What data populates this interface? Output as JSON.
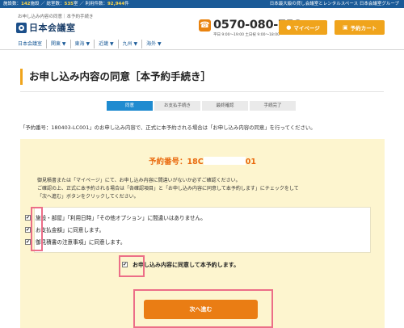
{
  "topbar": {
    "stats_prefix": "施設数：",
    "facilities": "142",
    "facilities_unit": "施設 ／ 総室数：",
    "rooms": "535",
    "rooms_unit": "室 ／ 利用件数：",
    "usage": "92,944",
    "usage_unit": "件",
    "tagline": "日本最大級の貸し会議室とレンタルスペース 日本会議室グループ"
  },
  "header": {
    "breadcrumb": "お申し込み内容の同意｜本予約手続き",
    "logo_text": "日本会議室",
    "phone": "0570-080-758",
    "hours": "平日 9:00〜19:00  土日祝 9:00〜18:00",
    "mypage_label": "マイページ",
    "cart_label": "予約カート"
  },
  "nav": {
    "items": [
      "日本会議室",
      "関東 ▼",
      "東海 ▼",
      "近畿 ▼",
      "九州 ▼",
      "海外 ▼"
    ]
  },
  "page": {
    "title": "お申し込み内容の同意［本予約手続き］"
  },
  "steps": [
    "同意",
    "お支払手続き",
    "最終確認",
    "手続完了"
  ],
  "intro": "「予約番号：180403-LC001」のお申し込み内容で、正式に本予約される場合は「お申し込み内容の同意」を行ってください。",
  "panel": {
    "resno_prefix": "予約番号：18C",
    "resno_suffix": "01",
    "desc_link1": "御見積書",
    "desc_mid": "または",
    "desc_link2": "「マイページ」",
    "desc_line1_rest": "にて、お申し込み内容に間違いがないか必ずご確認ください。",
    "desc_line2": "ご確認の上、正式に本予約される場合は「各確認項目」と「お申し込み内容に同意して本予約します」にチェックをして",
    "desc_line3": "「次へ進む」ボタンをクリックしてください。",
    "checks": [
      "施設・部屋」「利用日時」「その他オプション」に間違いはありません。",
      "お支払金額」に同意します。",
      "御見積書の注意事項」に同意します。"
    ],
    "agree_label": "お申し込み内容に同意して本予約します。",
    "next_label": "次へ進む"
  },
  "colors": {
    "brand_blue": "#1b5b98",
    "accent_orange": "#ea7d14",
    "highlight_pink": "#ec6e88",
    "panel_bg": "#fdf5cf"
  }
}
